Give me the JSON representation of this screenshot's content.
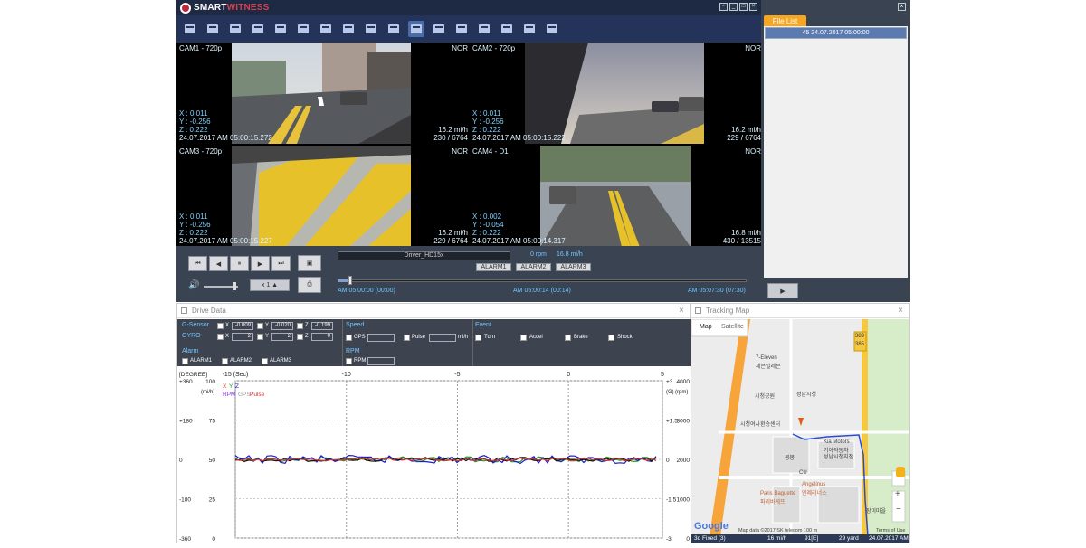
{
  "app": {
    "logo_brand": "SMART",
    "logo_brand2": "WITNESS"
  },
  "toolbar": {
    "icons": [
      "folder-icon",
      "folder-open-icon",
      "envelope-icon",
      "export-icon",
      "document-icon",
      "documents-icon",
      "map-pin-icon",
      "search-document-icon",
      "waveform-icon",
      "bar-settings-icon",
      "camera-view-icon",
      "network-icon",
      "database-icon",
      "play-prev-icon",
      "play-next-icon",
      "screenshot-icon",
      "chat-icon"
    ],
    "active_index": 10
  },
  "cameras": [
    {
      "label": "CAM1 - 720p",
      "mode": "NOR",
      "x": "X :  0.011",
      "y": "Y :  -0.256",
      "z": "Z :   0.222",
      "time": "24.07.2017 AM 05:00:15.272",
      "speed": "16.2 mi/h",
      "frames": "230 / 6764"
    },
    {
      "label": "CAM2 - 720p",
      "mode": "NOR",
      "x": "X :  0.011",
      "y": "Y :  -0.256",
      "z": "Z :   0.222",
      "time": "24.07.2017 AM 05:00:15.222",
      "speed": "16.2 mi/h",
      "frames": "229 / 6764"
    },
    {
      "label": "CAM3 - 720p",
      "mode": "NOR",
      "x": "X :  0.011",
      "y": "Y :  -0.256",
      "z": "Z :   0.222",
      "time": "24.07.2017 AM 05:00:15.227",
      "speed": "16.2 mi/h",
      "frames": "229 / 6764"
    },
    {
      "label": "CAM4 - D1",
      "mode": "NOR",
      "x": "X :  0.002",
      "y": "Y :  -0.054",
      "z": "Z :   0.222",
      "time": "24.07.2017 AM 05:00:14.317",
      "speed": "16.8 mi/h",
      "frames": "430 / 13515"
    }
  ],
  "playback": {
    "driver": "Driver_HD15x",
    "rpm": "0 rpm",
    "speed": "16.8 mi/h",
    "alarms": [
      "ALARM1",
      "ALARM2",
      "ALARM3"
    ],
    "speed_select": "x 1",
    "time_start": "AM 05:00:00 (00:00)",
    "time_current": "AM 05:00:14 (00:14)",
    "time_end": "AM 05:07:30 (07:30)",
    "progress": 0.03
  },
  "file_list": {
    "title": "File List",
    "items": [
      "45  24.07.2017 05:00:00"
    ]
  },
  "drive_data": {
    "title": "Drive Data",
    "gsensor": {
      "label": "G-Sensor",
      "x": "-0.009",
      "y": "-0.020",
      "z": "-0.199"
    },
    "gyro": {
      "label": "GYRO",
      "x": "2",
      "y": "2",
      "z": "0"
    },
    "speed": {
      "label": "Speed",
      "gps": "GPS",
      "pulse": "Pulse",
      "unit": "mi/h"
    },
    "event": {
      "label": "Event",
      "items": [
        "Turn",
        "Accel",
        "Brake",
        "Shock"
      ]
    },
    "alarm": {
      "label": "Alarm",
      "items": [
        "ALARM1",
        "ALARM2",
        "ALARM3"
      ]
    },
    "rpm": {
      "label": "RPM",
      "item": "RPM"
    },
    "axis": "X",
    "axis_y": "Y",
    "axis_z": "Z"
  },
  "chart_data": {
    "type": "line",
    "x_ticks": [
      "-15 (Sec)",
      "-10",
      "-5",
      "0",
      "5"
    ],
    "left_degree_label": "[DEGREE]",
    "left_degree": [
      "+360",
      "+180",
      "0",
      "-180",
      "-360"
    ],
    "left_speed_unit": "(mi/h)",
    "left_speed": [
      "100",
      "75",
      "50",
      "25",
      "0"
    ],
    "right_g_unit": "(G)",
    "right_g": [
      "+3",
      "+1.5",
      "0",
      "-1.5",
      "-3"
    ],
    "right_rpm_unit": "(rpm)",
    "right_rpm": [
      "4000",
      "3000",
      "2000",
      "1000",
      "0"
    ],
    "legend_xyz": [
      "X",
      "Y",
      "Z"
    ],
    "legend_line2": [
      "RPM",
      "GPS",
      "Pulse"
    ],
    "colors": {
      "x": "#1a9e1a",
      "y": "#1a1ad0",
      "z": "#111111",
      "rpm": "#8a2be2",
      "gps": "#3030ff",
      "pulse": "#d03030"
    },
    "series_note": "values fluctuate near 0 degree"
  },
  "tracking_map": {
    "title": "Tracking Map",
    "tabs": [
      "Map",
      "Satellite"
    ],
    "road_labels": [
      "389",
      "385"
    ],
    "places": [
      "7-Eleven",
      "세븐일레븐",
      "성남시청",
      "시청공원",
      "시청여사환승센터",
      "Kia Motors",
      "기아자동차",
      "성남시청지점",
      "봉봉",
      "CU",
      "Angelinus",
      "엔제리너스",
      "Paris Baguette",
      "파리바게뜨",
      "장미마을"
    ],
    "attribution": "Map data ©2017 SK telecom   100 m",
    "terms": "Terms of Use",
    "google": "Google",
    "status": [
      "3d Fixed (3)",
      "16 mi/h",
      "91[E]",
      "29 yard",
      "24.07.2017 AM"
    ]
  }
}
